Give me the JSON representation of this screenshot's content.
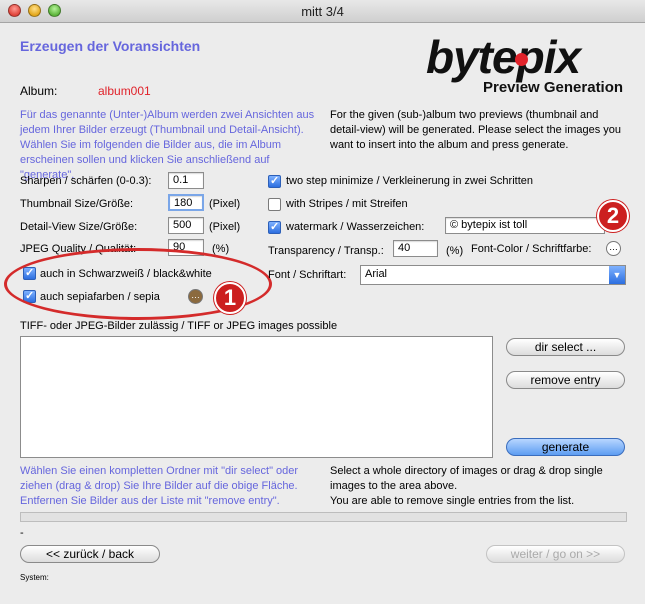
{
  "window": {
    "title": "mitt 3/4"
  },
  "heading": "Erzeugen der Voransichten",
  "logo": {
    "text_a": "byte",
    "text_b": "pix",
    "subtitle": "Preview Generation"
  },
  "album": {
    "label": "Album:",
    "value": "album001"
  },
  "intro_de": "Für das genannte (Unter-)Album werden zwei Ansichten aus jedem Ihrer Bilder erzeugt (Thumbnail und Detail-Ansicht). Wählen Sie im folgenden die Bilder aus, die im Album erscheinen sollen und klicken Sie anschließend auf \"generate\".",
  "intro_en": "For the given (sub-)album two previews (thumbnail and detail-view) will be generated. Please select the images you want to insert into the album and press generate.",
  "left": {
    "sharpen_label": "Sharpen / schärfen (0-0.3):",
    "sharpen_value": "0.1",
    "thumb_label": "Thumbnail Size/Größe:",
    "thumb_value": "180",
    "thumb_unit": "(Pixel)",
    "detail_label": "Detail-View Size/Größe:",
    "detail_value": "500",
    "detail_unit": "(Pixel)",
    "jpeg_label": "JPEG Quality / Qualität:",
    "jpeg_value": "90",
    "jpeg_unit": "(%)",
    "bw_label": "auch in Schwarzweiß / black&white",
    "sepia_label": "auch sepiafarben /  sepia"
  },
  "right": {
    "two_step_label": "two step minimize / Verkleinerung in zwei Schritten",
    "stripes_label": "with Stripes / mit Streifen",
    "watermark_label": "watermark / Wasserzeichen:",
    "watermark_value": "© bytepix ist toll",
    "transparency_label": "Transparency / Transp.:",
    "transparency_value": "40",
    "transparency_unit": "(%)",
    "font_color_label": "Font-Color / Schriftfarbe:",
    "font_label": "Font / Schriftart:",
    "font_value": "Arial"
  },
  "list": {
    "label": "TIFF- oder JPEG-Bilder zulässig / TIFF or JPEG images possible",
    "dir_select": "dir select ...",
    "remove_entry": "remove entry",
    "generate": "generate"
  },
  "help_de": "Wählen Sie einen kompletten Ordner mit \"dir select\" oder ziehen (drag & drop) Sie Ihre Bilder auf die obige Fläche. Entfernen Sie Bilder aus der Liste mit \"remove entry\".",
  "help_en_1": "Select a whole directory of images or drag & drop single images to the area above.",
  "help_en_2": "You are able to remove single entries from the list.",
  "progress_dash": "-",
  "nav": {
    "back": "<< zurück / back",
    "next": "weiter / go on >>"
  },
  "system_label": "System:",
  "annotations": {
    "badge1": "1",
    "badge2": "2"
  },
  "colors": {
    "accent_purple": "#6666dd",
    "album_red": "#e0222a",
    "annotation_red": "#cc1f1f"
  }
}
